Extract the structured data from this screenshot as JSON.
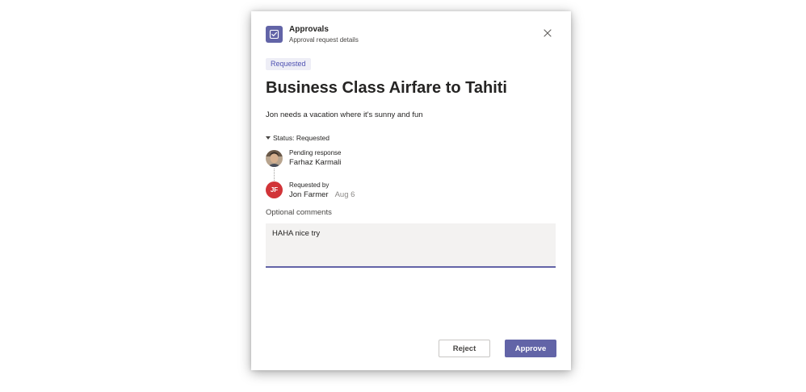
{
  "header": {
    "app_name": "Approvals",
    "app_subtitle": "Approval request details",
    "app_icon": "approvals-checklist-icon",
    "close_icon": "close-icon"
  },
  "request": {
    "status_badge": "Requested",
    "title": "Business Class Airfare to Tahiti",
    "description": "Jon needs a vacation where it's sunny and fun"
  },
  "status_section": {
    "toggle_label": "Status: Requested",
    "approver": {
      "label": "Pending response",
      "name": "Farhaz Karmali",
      "avatar": "photo"
    },
    "requester": {
      "label": "Requested by",
      "name": "Jon Farmer",
      "date": "Aug 6",
      "initials": "JF",
      "avatar_color": "#d13438"
    }
  },
  "comments": {
    "label": "Optional comments",
    "value": "HAHA nice try"
  },
  "actions": {
    "reject_label": "Reject",
    "approve_label": "Approve"
  },
  "colors": {
    "accent": "#6264a7",
    "badge_bg": "#eeeef6",
    "requester_avatar": "#d13438"
  }
}
